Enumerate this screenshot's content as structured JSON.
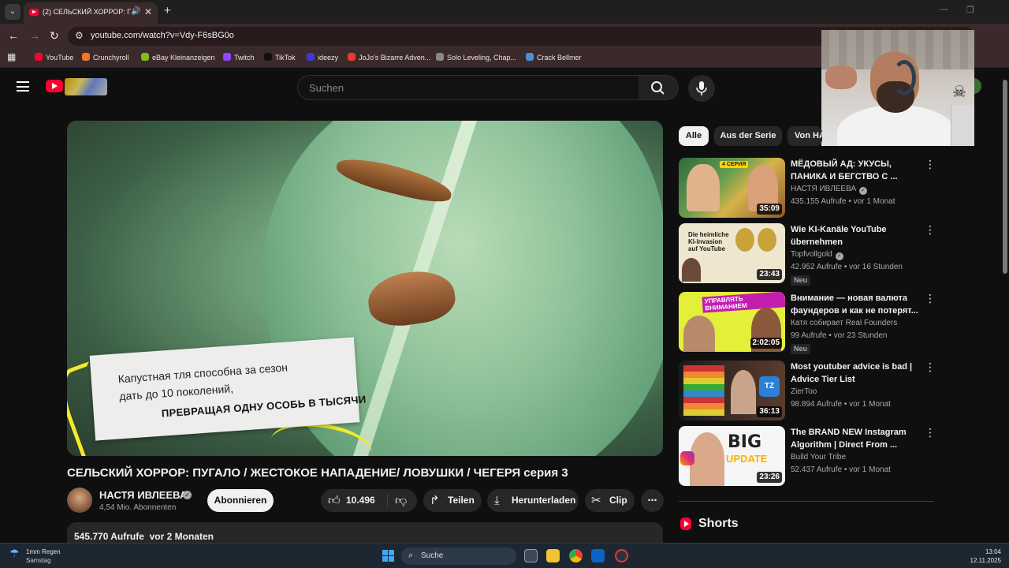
{
  "browser": {
    "tab_title": "(2) СЕЛЬСКИЙ ХОРРОР: ПУ",
    "url": "youtube.com/watch?v=Vdy-F6sBG0o",
    "bookmarks": [
      {
        "label": "YouTube",
        "color": "#ff0033"
      },
      {
        "label": "Crunchyroll",
        "color": "#f47521"
      },
      {
        "label": "eBay Kleinanzeigen",
        "color": "#86b817"
      },
      {
        "label": "Twitch",
        "color": "#9146ff"
      },
      {
        "label": "TikTok",
        "color": "#111111"
      },
      {
        "label": "ideezy",
        "color": "#3b3bd9"
      },
      {
        "label": "JoJo's Bizarre Adven...",
        "color": "#e03c31"
      },
      {
        "label": "Solo Leveling, Chap...",
        "color": "#888888"
      },
      {
        "label": "Crack Bellmer",
        "color": "#4a90d9"
      }
    ]
  },
  "youtube": {
    "search_placeholder": "Suchen",
    "player": {
      "caption_line1": "Капустная тля способна за сезон",
      "caption_line2": "дать до 10 поколений,",
      "caption_line3": "ПРЕВРАЩАЯ ОДНУ ОСОБЬ В ТЫСЯЧИ"
    },
    "video": {
      "title": "СЕЛЬСКИЙ ХОРРОР: ПУГАЛО / ЖЕСТОКОЕ НАПАДЕНИЕ/ ЛОВУШКИ / ЧЕГЕРЯ серия 3",
      "channel": "НАСТЯ ИВЛЕЕВА",
      "subscribers": "4,54 Mio. Abonnenten",
      "subscribe_label": "Abonnieren",
      "likes": "10.496",
      "share_label": "Teilen",
      "download_label": "Herunterladen",
      "clip_label": "Clip",
      "views": "545.770 Aufrufe",
      "date": "vor 2 Monaten"
    },
    "chips": [
      "Alle",
      "Aus der Serie",
      "Von HA"
    ],
    "recommendations": [
      {
        "title": "МЁДОВЫЙ АД: УКУСЫ, ПАНИКА И БЕГСТВО С ...",
        "channel": "НАСТЯ ИВЛЕЕВА",
        "verified": true,
        "stats": "435.155 Aufrufe • vor 1 Monat",
        "duration": "35:09",
        "badge": ""
      },
      {
        "title": "Wie KI-Kanäle YouTube übernehmen",
        "channel": "Topfvollgold",
        "verified": true,
        "stats": "42.952 Aufrufe • vor 16 Stunden",
        "duration": "23:43",
        "badge": "Neu"
      },
      {
        "title": "Внимание — новая валюта фаундеров и как не потерят...",
        "channel": "Катя собирает Real Founders",
        "verified": false,
        "stats": "99 Aufrufe • vor 23 Stunden",
        "duration": "2:02:05",
        "badge": "Neu"
      },
      {
        "title": "Most youtuber advice is bad | Advice Tier List",
        "channel": "ZierToo",
        "verified": false,
        "stats": "98.894 Aufrufe • vor 1 Monat",
        "duration": "36:13",
        "badge": ""
      },
      {
        "title": "The BRAND NEW Instagram Algorithm | Direct From ...",
        "channel": "Build Your Tribe",
        "verified": false,
        "stats": "52.437 Aufrufe • vor 1 Monat",
        "duration": "23:26",
        "badge": ""
      }
    ],
    "shorts_label": "Shorts"
  },
  "thumb_text": {
    "t1_badge": "4 СЕРИЯ",
    "t2_text": "Die heimliche KI-Invasion auf YouTube",
    "t3_text": "УПРАВЛЯТЬ ВНИМАНИЕМ",
    "t5_big": "BIG",
    "t5_update": "UPDATE"
  },
  "taskbar": {
    "weather_line1": "1mm Regen",
    "weather_line2": "Samstag",
    "search_label": "Suche",
    "time": "13:04",
    "date": "12.11.2025"
  }
}
